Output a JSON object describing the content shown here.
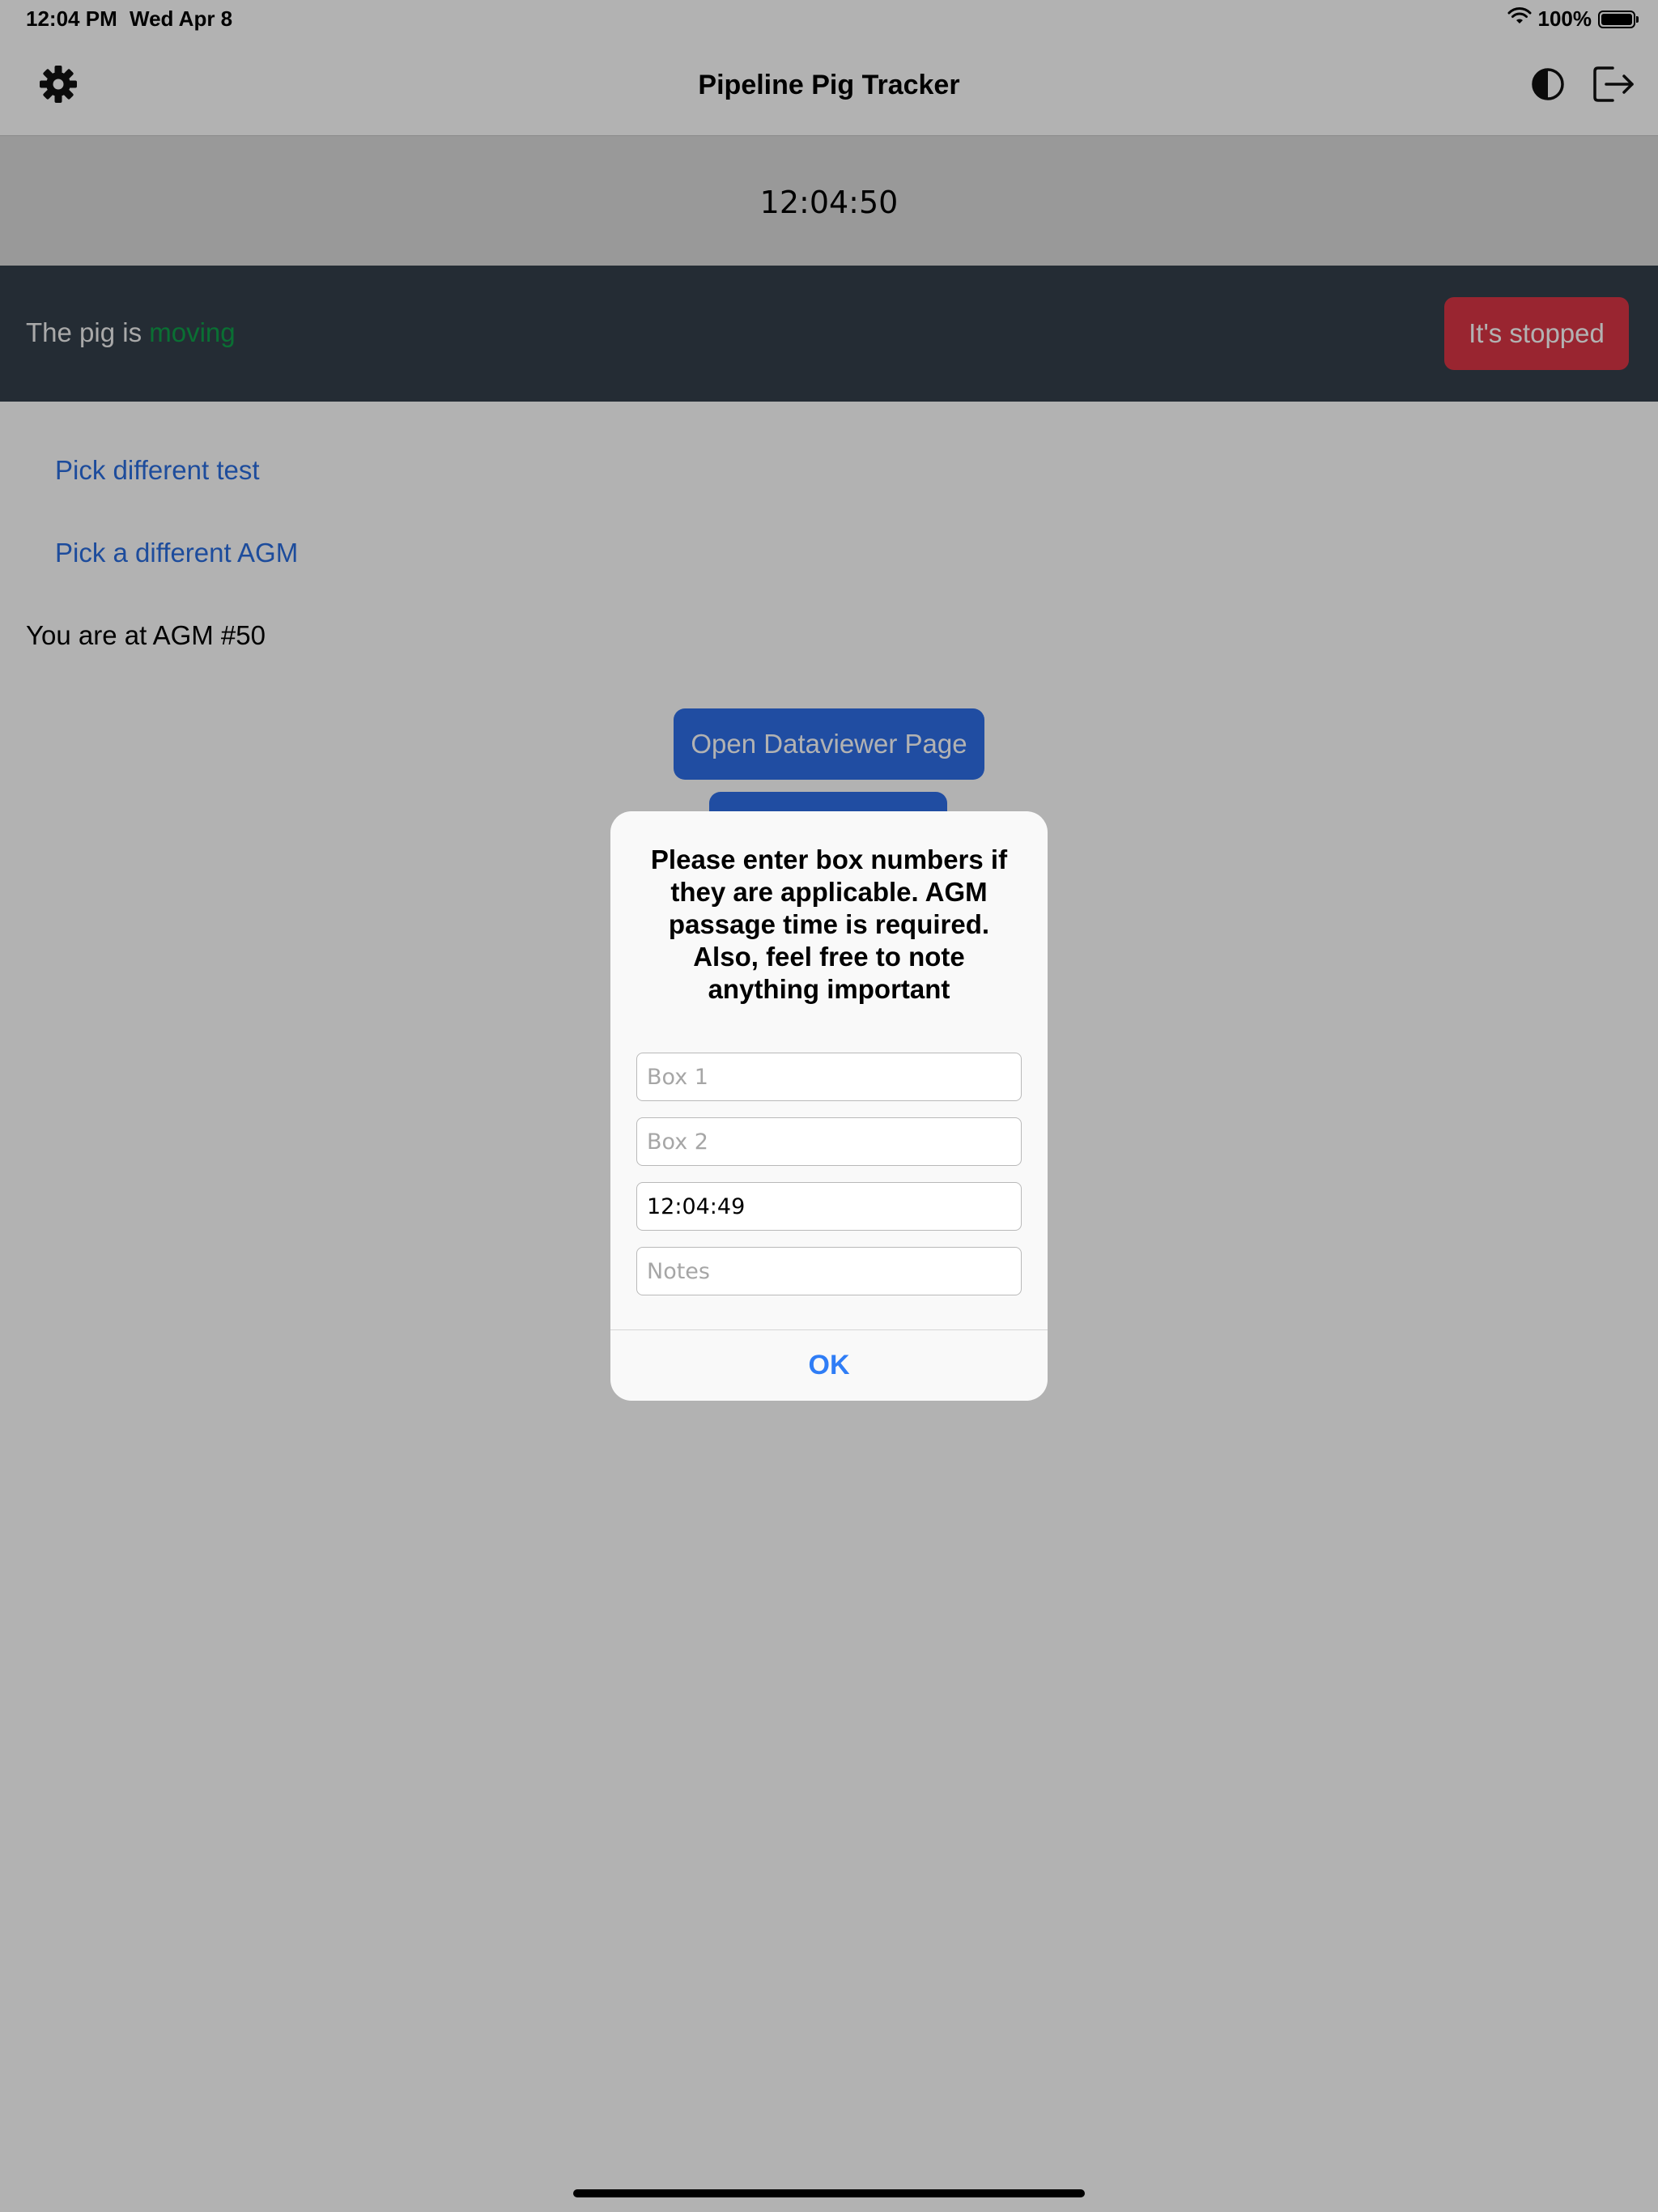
{
  "status_bar": {
    "time": "12:04 PM",
    "date": "Wed Apr 8",
    "battery": "100%",
    "icons": [
      "wifi-icon",
      "battery-icon"
    ]
  },
  "nav": {
    "title": "Pipeline Pig Tracker",
    "left_icon": "gear-icon",
    "right_icons": [
      "contrast-icon",
      "logout-icon"
    ]
  },
  "clock": {
    "time": "12:04:50"
  },
  "pig_status": {
    "prefix": "The pig is ",
    "state": "moving",
    "state_color": "#0fa04a",
    "button_label": "It's stopped",
    "button_color": "#dc3545"
  },
  "links": {
    "pick_test": "Pick different test",
    "pick_agm": "Pick a different AGM"
  },
  "location": {
    "label": "You are at AGM #50"
  },
  "buttons": {
    "dataviewer": "Open Dataviewer Page"
  },
  "alert": {
    "message": "Please enter box numbers if they are applicable. AGM passage time is required. Also, feel free to note anything important",
    "fields": {
      "box1_placeholder": "Box 1",
      "box2_placeholder": "Box 2",
      "time_value": "12:04:49",
      "notes_placeholder": "Notes"
    },
    "ok_label": "OK"
  },
  "colors": {
    "accent": "#2f6fe8",
    "link": "#2a6ee0",
    "band": "#34404b"
  }
}
